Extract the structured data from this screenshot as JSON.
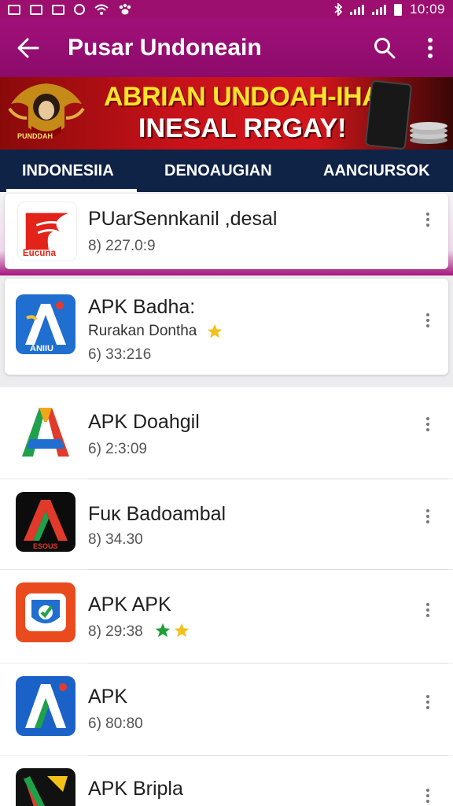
{
  "status_bar": {
    "time": "10:09"
  },
  "app_bar": {
    "title": "Pusar Undoneain"
  },
  "banner": {
    "line1": "ABRIAN UNDOAH-IHAIN",
    "line2": "INESAL RRGAY!",
    "emblem_text": "PUNDDAH"
  },
  "tabs": [
    {
      "label": "INDONESIIA"
    },
    {
      "label": "DENOAUGIAN"
    },
    {
      "label": "AANCIURSOK"
    }
  ],
  "items": [
    {
      "name": "PUarSennkanil ,desal",
      "meta": "8) 227.0:9",
      "icon_text": "Eucuna"
    },
    {
      "name": "APK Badha:",
      "sub": "Rurakan Dontha",
      "meta": "6) 33:216",
      "icon_text": "ANIIU"
    },
    {
      "name": "APK Doahgil",
      "meta": "6) 2:3:09"
    },
    {
      "name": "Fuκ Badoambal",
      "meta": "8) 34.30",
      "icon_text": "ESOUS"
    },
    {
      "name": "APK APK",
      "meta": "8) 29:38"
    },
    {
      "name": "APK",
      "meta": "6) 80:80"
    },
    {
      "name": "APK Bripla"
    }
  ],
  "colors": {
    "primary": "#9c0f6f",
    "tab_bar": "#0f2346",
    "banner_red": "#c8121a",
    "star_green": "#1f9e3a",
    "star_gold": "#f2c21b"
  }
}
